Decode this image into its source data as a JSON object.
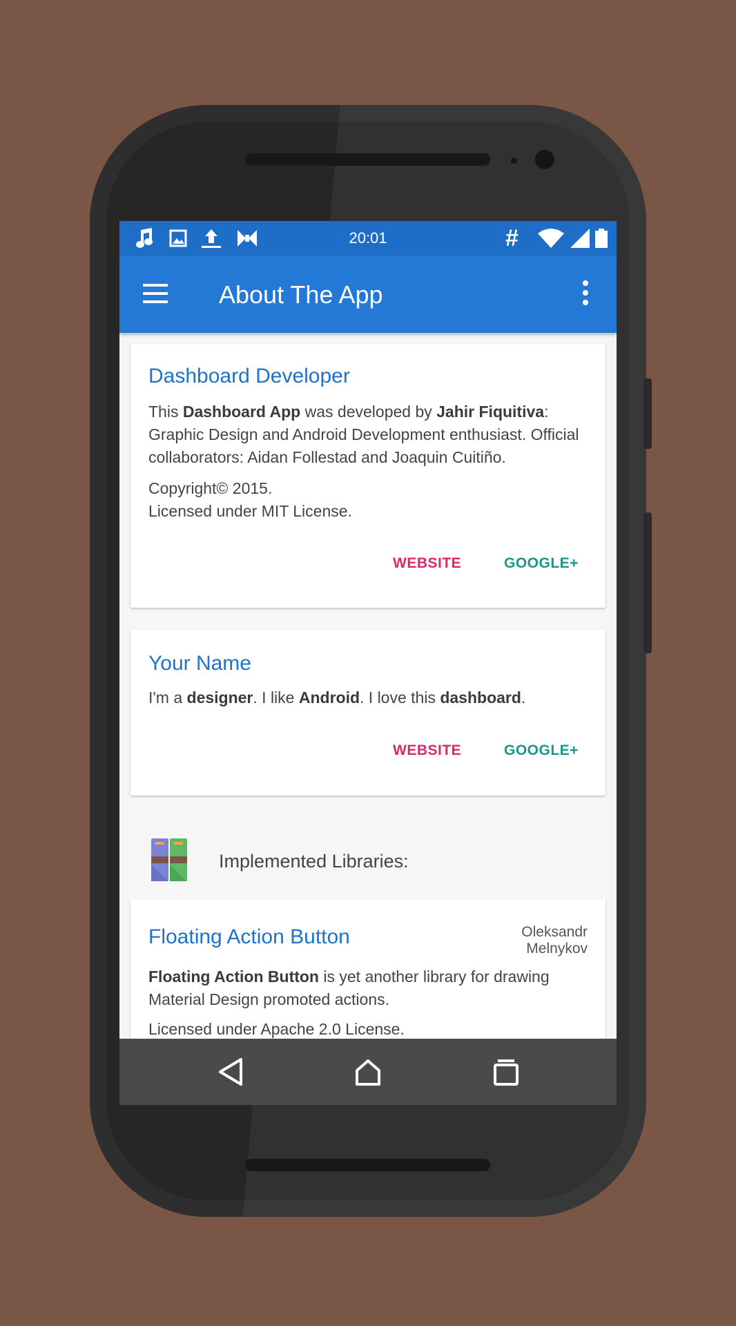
{
  "status_bar": {
    "time": "20:01",
    "left_icons": [
      "music-note-icon",
      "image-icon",
      "upload-icon",
      "bowtie-icon"
    ],
    "right_icons": [
      "hash-icon",
      "wifi-icon",
      "signal-icon",
      "battery-icon"
    ],
    "hash_glyph": "#"
  },
  "app_bar": {
    "title": "About The App",
    "menu_icon": "menu-icon",
    "overflow_icon": "more-vert-icon"
  },
  "cards": {
    "developer": {
      "title": "Dashboard Developer",
      "p1": {
        "t1": "This ",
        "b1": "Dashboard App",
        "t2": " was developed by ",
        "b2": "Jahir Fiquitiva",
        "t3": ": Graphic Design and Android Development enthusiast. Official collaborators: Aidan Follestad and Joaquin Cuitiño."
      },
      "p2_line1": "Copyright© 2015.",
      "p2_line2": "Licensed under MIT License.",
      "website_label": "WEBSITE",
      "google_label": "GOOGLE+"
    },
    "your_name": {
      "title": "Your Name",
      "p1": {
        "t1": "I'm a ",
        "b1": "designer",
        "t2": ". I like ",
        "b2": "Android",
        "t3": ". I love this ",
        "b3": "dashboard",
        "t4": "."
      },
      "website_label": "WEBSITE",
      "google_label": "GOOGLE+"
    }
  },
  "libraries": {
    "header_label": "Implemented Libraries:",
    "header_icon": "books-icon",
    "items": [
      {
        "title": "Floating Action Button",
        "author_line1": "Oleksandr",
        "author_line2": "Melnykov",
        "desc_bold": "Floating Action Button",
        "desc_rest": " is yet another library for drawing Material Design promoted actions.",
        "license": "Licensed under Apache 2.0 License."
      }
    ]
  },
  "nav_bar": {
    "back_icon": "back-icon",
    "home_icon": "home-icon",
    "recents_icon": "recents-icon"
  },
  "colors": {
    "status_bar": "#1e6ec8",
    "app_bar": "#2379d5",
    "card_title": "#1f72c9",
    "website_button": "#e0266b",
    "google_button": "#18988b",
    "background": "#7a5646"
  }
}
